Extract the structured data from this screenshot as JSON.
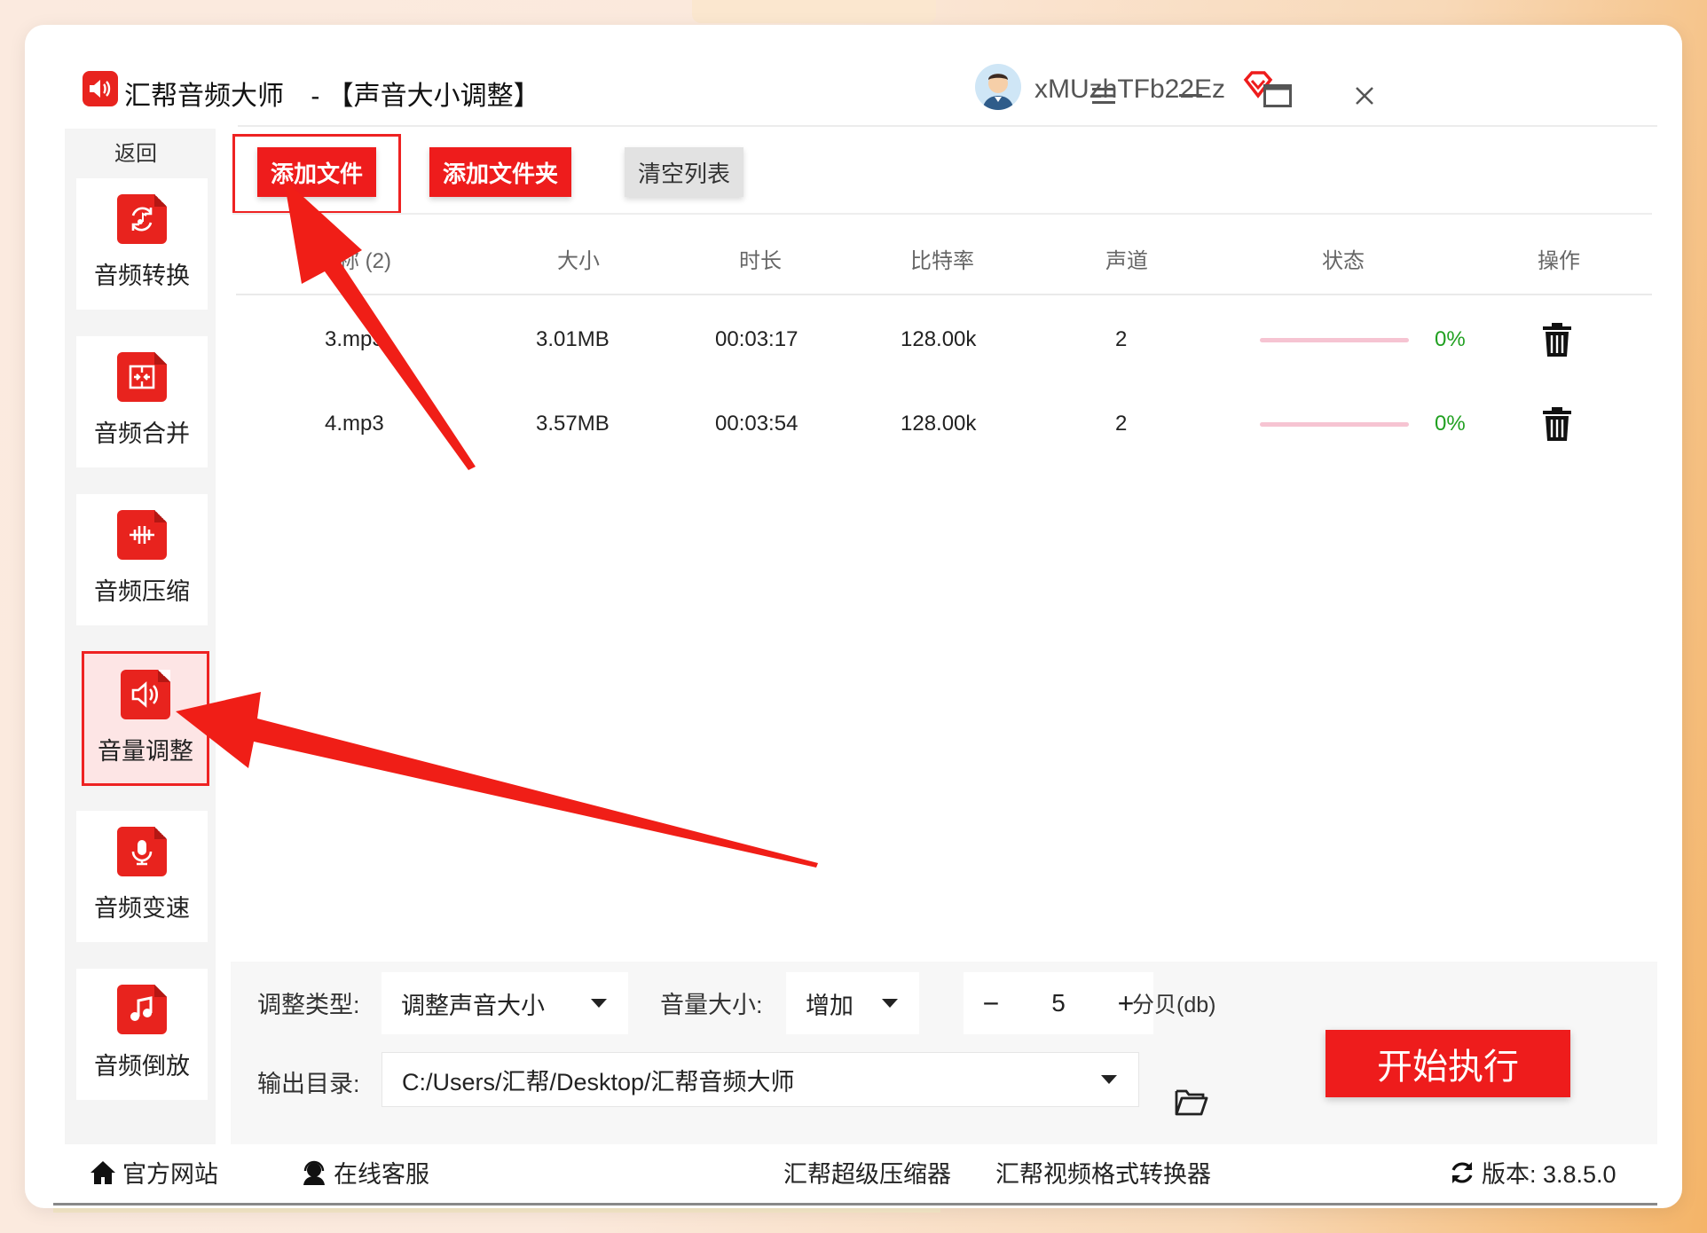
{
  "app": {
    "name": "汇帮音频大师",
    "page_title": "-  【声音大小调整】",
    "username": "xMUzhTFb22Ez"
  },
  "sidebar": {
    "back_label": "返回",
    "items": [
      {
        "label": "音频转换",
        "icon": "audio-convert-icon"
      },
      {
        "label": "音频合并",
        "icon": "audio-merge-icon"
      },
      {
        "label": "音频压缩",
        "icon": "audio-compress-icon"
      },
      {
        "label": "音量调整",
        "icon": "volume-icon",
        "active": true
      },
      {
        "label": "音频变速",
        "icon": "microphone-icon"
      },
      {
        "label": "音频倒放",
        "icon": "music-note-icon"
      }
    ]
  },
  "toolbar": {
    "add_file": "添加文件",
    "add_folder": "添加文件夹",
    "clear_list": "清空列表"
  },
  "table": {
    "headers": {
      "name": "称 (2)",
      "size": "大小",
      "duration": "时长",
      "bitrate": "比特率",
      "channels": "声道",
      "status": "状态",
      "action": "操作"
    },
    "rows": [
      {
        "name": "3.mp3",
        "size": "3.01MB",
        "duration": "00:03:17",
        "bitrate": "128.00k",
        "channels": "2",
        "progress": 0,
        "status": "0%"
      },
      {
        "name": "4.mp3",
        "size": "3.57MB",
        "duration": "00:03:54",
        "bitrate": "128.00k",
        "channels": "2",
        "progress": 0,
        "status": "0%"
      }
    ]
  },
  "settings": {
    "adjust_type_label": "调整类型:",
    "adjust_type_value": "调整声音大小",
    "volume_label": "音量大小:",
    "volume_mode": "增加",
    "volume_minus": "−",
    "volume_value": "5",
    "volume_plus": "+",
    "volume_unit": "分贝(db)",
    "output_label": "输出目录:",
    "output_path": "C:/Users/汇帮/Desktop/汇帮音频大师",
    "start_button": "开始执行"
  },
  "footer": {
    "website": "官方网站",
    "support": "在线客服",
    "compressor": "汇帮超级压缩器",
    "video_converter": "汇帮视频格式转换器",
    "version": "版本:  3.8.5.0"
  },
  "colors": {
    "accent": "#ee1c1c",
    "progress_track": "#f6c4d2",
    "status_green": "#20a020"
  }
}
